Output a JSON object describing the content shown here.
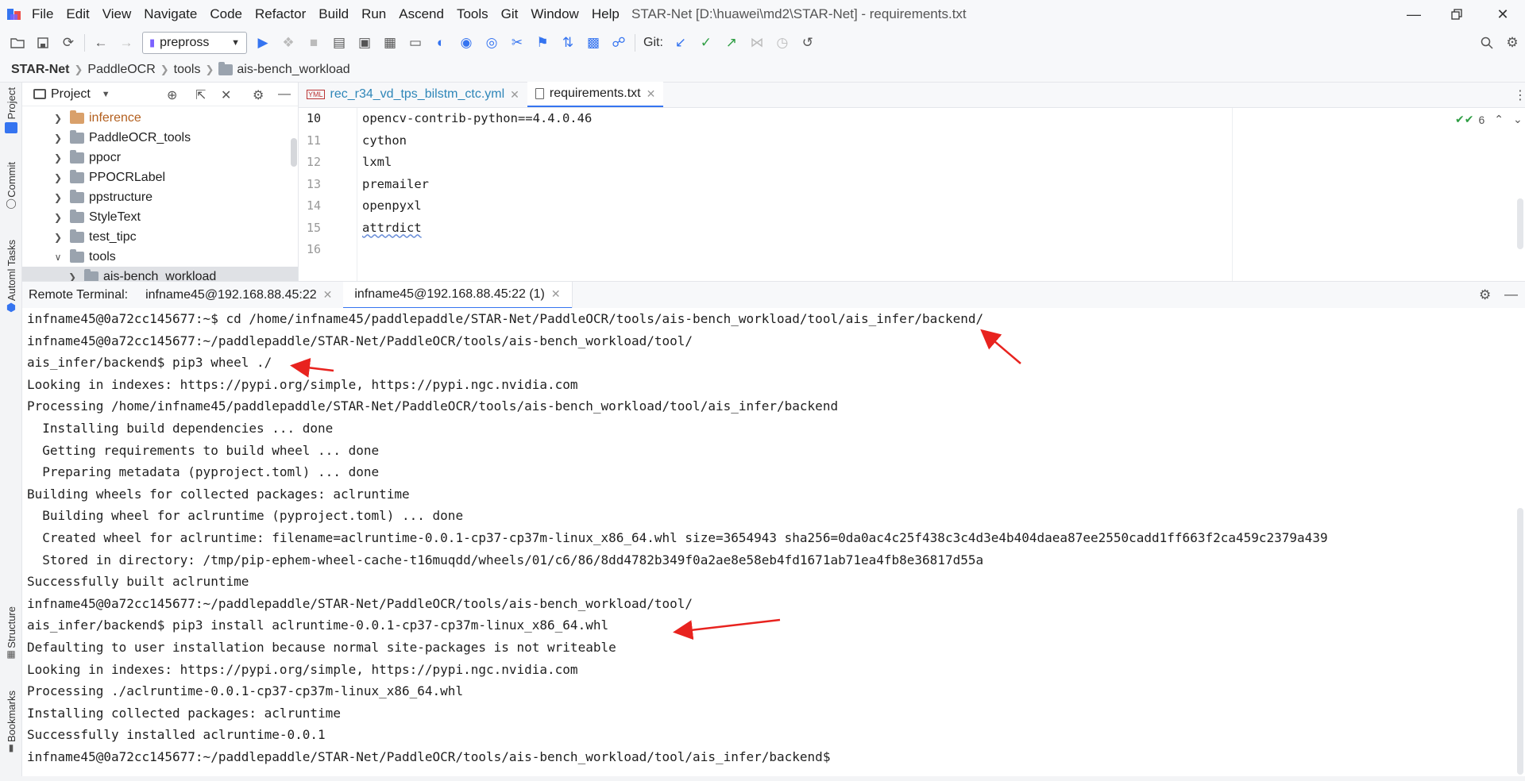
{
  "menubar": {
    "items": [
      "File",
      "Edit",
      "View",
      "Navigate",
      "Code",
      "Refactor",
      "Build",
      "Run",
      "Ascend",
      "Tools",
      "Git",
      "Window",
      "Help"
    ],
    "title": "STAR-Net [D:\\huawei\\md2\\STAR-Net] - requirements.txt"
  },
  "toolbar": {
    "run_config": "prepross",
    "git_label": "Git:"
  },
  "breadcrumb": [
    "STAR-Net",
    "PaddleOCR",
    "tools",
    "ais-bench_workload"
  ],
  "sidebar": {
    "project_tab": "Project",
    "commit_tab": "Commit",
    "tasks_tab": "Automl Tasks",
    "structure_tab": "Structure",
    "bookmarks_tab": "Bookmarks"
  },
  "project_panel": {
    "title": "Project",
    "tree": [
      {
        "label": "inference",
        "expanded": false,
        "level": 1,
        "highlight": true
      },
      {
        "label": "PaddleOCR_tools",
        "expanded": false,
        "level": 1
      },
      {
        "label": "ppocr",
        "expanded": false,
        "level": 1
      },
      {
        "label": "PPOCRLabel",
        "expanded": false,
        "level": 1
      },
      {
        "label": "ppstructure",
        "expanded": false,
        "level": 1
      },
      {
        "label": "StyleText",
        "expanded": false,
        "level": 1
      },
      {
        "label": "test_tipc",
        "expanded": false,
        "level": 1
      },
      {
        "label": "tools",
        "expanded": true,
        "level": 1
      },
      {
        "label": "ais-bench_workload",
        "expanded": false,
        "level": 2,
        "selected": true
      }
    ]
  },
  "editor": {
    "tabs": [
      {
        "label": "rec_r34_vd_tps_bilstm_ctc.yml",
        "active": false
      },
      {
        "label": "requirements.txt",
        "active": true
      }
    ],
    "inspection_count": "6",
    "lines": [
      {
        "num": "10",
        "text": "opencv-contrib-python==4.4.0.46"
      },
      {
        "num": "11",
        "text": "cython"
      },
      {
        "num": "12",
        "text": "lxml"
      },
      {
        "num": "13",
        "text": "premailer"
      },
      {
        "num": "14",
        "text": "openpyxl"
      },
      {
        "num": "15",
        "text": "attrdict"
      },
      {
        "num": "16",
        "text": ""
      }
    ]
  },
  "terminal": {
    "label": "Remote Terminal:",
    "tabs": [
      {
        "label": "infname45@192.168.88.45:22",
        "active": false
      },
      {
        "label": "infname45@192.168.88.45:22 (1)",
        "active": true
      }
    ],
    "lines": [
      "infname45@0a72cc145677:~$ cd /home/infname45/paddlepaddle/STAR-Net/PaddleOCR/tools/ais-bench_workload/tool/ais_infer/backend/",
      "infname45@0a72cc145677:~/paddlepaddle/STAR-Net/PaddleOCR/tools/ais-bench_workload/tool/",
      "ais_infer/backend$ pip3 wheel ./",
      "Looking in indexes: https://pypi.org/simple, https://pypi.ngc.nvidia.com",
      "Processing /home/infname45/paddlepaddle/STAR-Net/PaddleOCR/tools/ais-bench_workload/tool/ais_infer/backend",
      "  Installing build dependencies ... done",
      "  Getting requirements to build wheel ... done",
      "  Preparing metadata (pyproject.toml) ... done",
      "Building wheels for collected packages: aclruntime",
      "  Building wheel for aclruntime (pyproject.toml) ... done",
      "  Created wheel for aclruntime: filename=aclruntime-0.0.1-cp37-cp37m-linux_x86_64.whl size=3654943 sha256=0da0ac4c25f438c3c4d3e4b404daea87ee2550cadd1ff663f2ca459c2379a439",
      "  Stored in directory: /tmp/pip-ephem-wheel-cache-t16muqdd/wheels/01/c6/86/8dd4782b349f0a2ae8e58eb4fd1671ab71ea4fb8e36817d55a",
      "Successfully built aclruntime",
      "infname45@0a72cc145677:~/paddlepaddle/STAR-Net/PaddleOCR/tools/ais-bench_workload/tool/",
      "ais_infer/backend$ pip3 install aclruntime-0.0.1-cp37-cp37m-linux_x86_64.whl",
      "Defaulting to user installation because normal site-packages is not writeable",
      "Looking in indexes: https://pypi.org/simple, https://pypi.ngc.nvidia.com",
      "Processing ./aclruntime-0.0.1-cp37-cp37m-linux_x86_64.whl",
      "Installing collected packages: aclruntime",
      "Successfully installed aclruntime-0.0.1",
      "infname45@0a72cc145677:~/paddlepaddle/STAR-Net/PaddleOCR/tools/ais-bench_workload/tool/ais_infer/backend$"
    ]
  },
  "colors": {
    "accent": "#3574f0",
    "annotation_arrow": "#e8231f",
    "run_green": "#2f9e44",
    "highlight_folder_text": "#b35f1e"
  }
}
